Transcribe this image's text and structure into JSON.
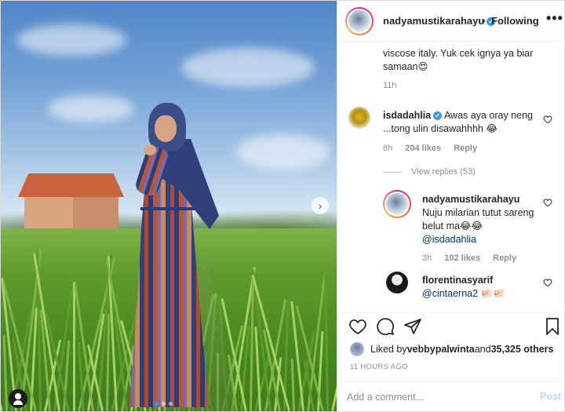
{
  "post": {
    "username": "nadyamustikarahayu",
    "verified_mark": "✔",
    "separator": "•",
    "follow_status": "Following",
    "more_label": "•••",
    "next_arrow": "›"
  },
  "caption": {
    "tail_text": "viscose italy. Yuk cek ignya ya biar samaan😍",
    "time": "11h"
  },
  "comments": [
    {
      "username": "isdadahlia",
      "verified": true,
      "text": "Awas aya oray neng ...tong ulin disawahhhh 😂",
      "time": "8h",
      "likes": "204 likes",
      "reply_label": "Reply",
      "view_replies": "View replies (53)"
    },
    {
      "username": "nadyamustikarahayu",
      "text": "Nuju milarian tutut sareng belut ma😂😂",
      "mention": "@isdadahlia",
      "time": "3h",
      "likes": "102 likes",
      "reply_label": "Reply"
    },
    {
      "username": "florentinasyarif",
      "mention": "@cintaerna2",
      "emoji": "🐖🐖"
    }
  ],
  "actions": {
    "liked_prefix": "Liked by ",
    "liked_user": "vebbypalwinta",
    "liked_middle": " and ",
    "liked_count": "35,325 others",
    "time_ago": "11 HOURS AGO",
    "comment_placeholder": "Add a comment...",
    "post_label": "Post"
  },
  "colors": {
    "link": "#00376b",
    "verified": "#3897f0",
    "muted": "#8e8e8e",
    "post_disabled": "#b2dffc"
  },
  "icons": [
    "heart-icon",
    "comment-icon",
    "share-icon",
    "bookmark-icon",
    "user-tag-icon",
    "more-icon"
  ]
}
